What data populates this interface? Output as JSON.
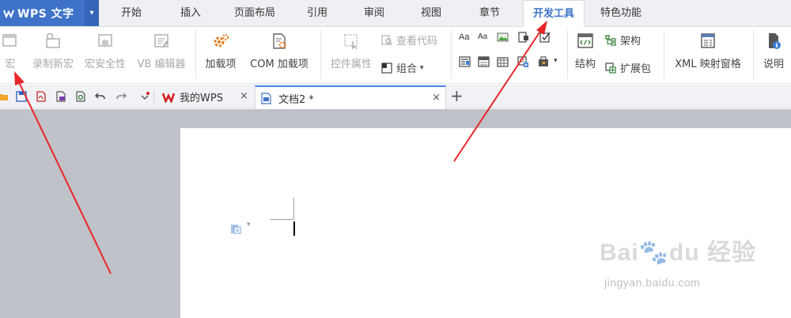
{
  "app": {
    "title": "WPS 文字",
    "dropdown_glyph": "▾"
  },
  "menu_tabs": [
    "开始",
    "插入",
    "页面布局",
    "引用",
    "审阅",
    "视图",
    "章节",
    "开发工具",
    "特色功能"
  ],
  "ribbon": {
    "macro": "宏",
    "record_macro": "录制新宏",
    "macro_security": "宏安全性",
    "vb_editor": "VB 编辑器",
    "addins": "加载项",
    "com_addins": "COM 加载项",
    "control_props": "控件属性",
    "view_code": "查看代码",
    "group": "组合",
    "structure": "架构",
    "structure_big": "结构",
    "expansion": "扩展包",
    "xml_mapping": "XML 映射窗格",
    "help": "说明",
    "caret": "▾"
  },
  "doc_tabs": [
    {
      "label": "我的WPS",
      "close": "×"
    },
    {
      "label": "文档2 *",
      "close": "×"
    }
  ],
  "new_tab_glyph": "+",
  "watermark": {
    "logo": "Bai🐾du 经验",
    "url": "jingyan.baidu.com"
  },
  "colors": {
    "accent": "#3f73c9",
    "arrow": "#e8262a",
    "active_tab_line": "#4a8ee6"
  }
}
